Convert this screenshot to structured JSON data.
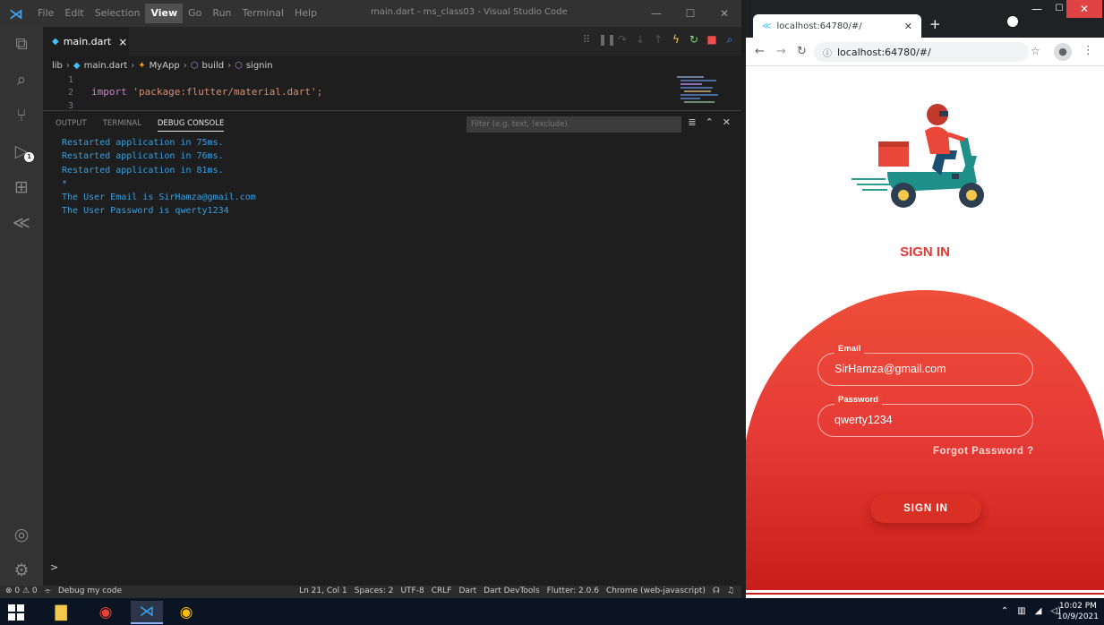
{
  "vscode": {
    "menu": [
      "File",
      "Edit",
      "Selection",
      "View",
      "Go",
      "Run",
      "Terminal",
      "Help"
    ],
    "active_menu": "View",
    "window_title": "main.dart - ms_class03 - Visual Studio Code",
    "tab": {
      "filename": "main.dart",
      "close": "×"
    },
    "breadcrumb": [
      "lib",
      "main.dart",
      "MyApp",
      "build",
      "signin"
    ],
    "editor_lines": [
      {
        "num": "1",
        "keyword": "",
        "string": ""
      },
      {
        "num": "2",
        "keyword": "import",
        "string": "'package:flutter/material.dart';"
      },
      {
        "num": "3",
        "keyword": "",
        "string": ""
      }
    ],
    "panel_tabs": [
      "OUTPUT",
      "TERMINAL",
      "DEBUG CONSOLE"
    ],
    "active_panel_tab": "DEBUG CONSOLE",
    "filter_placeholder": "Filter (e.g. text, !exclude)",
    "console_lines": [
      "Restarted application in 75ms.",
      "Restarted application in 76ms.",
      "Restarted application in 81ms.",
      "*",
      "The User Email is SirHamza@gmail.com",
      "The User Password is qwerty1234"
    ],
    "prompt": ">",
    "activity_badge": "1",
    "status_left": [
      "⊗ 0 ⚠ 0",
      "Debug my code"
    ],
    "status_right": [
      "Ln 21, Col 1",
      "Spaces: 2",
      "UTF-8",
      "CRLF",
      "Dart",
      "Dart DevTools",
      "Flutter: 2.0.6",
      "Chrome (web-javascript)"
    ]
  },
  "chrome": {
    "tab_title": "localhost:64780/#/",
    "url": "localhost:64780/#/",
    "url_muted": ":64780/#/",
    "url_host": "localhost"
  },
  "app": {
    "title": "SIGN IN",
    "email_label": "Email",
    "email_value": "SirHamza@gmail.com",
    "password_label": "Password",
    "password_value": "qwerty1234",
    "forgot": "Forgot Password ?",
    "button": "SIGN IN"
  },
  "taskbar": {
    "time": "10:02 PM",
    "date": "10/9/2021"
  },
  "colors": {
    "accent_red": "#e53935",
    "console_blue": "#3b9ddd",
    "vscode_bg": "#1e1e1e"
  }
}
